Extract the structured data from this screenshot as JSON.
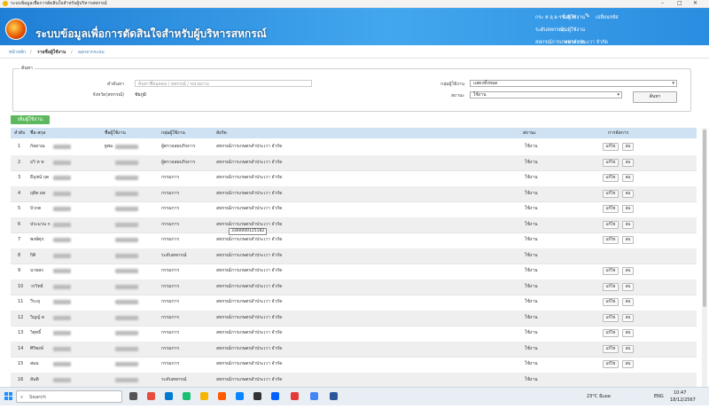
{
  "window": {
    "title": "ระบบข้อมูลเพื่อการตัดสินใจสำหรับผู้บริหารสหกรณ์",
    "controls": [
      "–",
      "□",
      "✕"
    ]
  },
  "header": {
    "site_title": "ระบบข้อมูลเพื่อการตัดสินใจสำหรับผู้บริหารสหกรณ์",
    "user_label": "ชื่อผู้ใช้งาน",
    "user_value": "กระ ห ลุ ผ-ร ะ ถิ ต",
    "group_label": "กลุ่มผู้ใช้งาน",
    "group_value": "ระดับสหกรณ์",
    "unit_label": "หน่วยงาน",
    "unit_value": "สหกรณ์การเกษตรลำประเวา จำกัด",
    "change_password": "เปลี่ยนรหัส"
  },
  "breadcrumb": {
    "home": "หน้าหลัก",
    "current": "รายชื่อผู้ใช้งาน",
    "logout": "ออกจากระบบ",
    "sep": "/"
  },
  "search": {
    "legend": "ค้นหา",
    "keyword_label": "คำค้นหา",
    "keyword_placeholder": "ค้นหาชื่อบุคคล / สหกรณ์ / หน่วยงาน",
    "province_label": "จังหวัด(สหกรณ์)",
    "province_value": "ชัยภูมิ",
    "group_label": "กลุ่มผู้ใช้งาน",
    "group_value": "แสดงทั้งหมด",
    "status_label": "สถานะ",
    "status_value": "ใช้งาน",
    "search_button": "ค้นหา"
  },
  "add_user_button": "เพิ่มผู้ใช้งาน",
  "table": {
    "columns": [
      "ลำดับ",
      "ชื่อ-สกุล",
      "ชื่อผู้ใช้งาน",
      "กลุ่มผู้ใช้งาน",
      "สังกัด",
      "สถานะ",
      "การจัดการ"
    ],
    "edit_label": "แก้ไข",
    "delete_label": "ลบ",
    "rows": [
      {
        "no": "1",
        "name": "กัลยาณ",
        "username": "ฐพม",
        "group": "ผู้ตรวจสอบกิจการ",
        "org": "สหกรณ์การเกษตรลำประเวา จำกัด",
        "status": "ใช้งาน"
      },
      {
        "no": "2",
        "name": "อวิ ห ท",
        "username": "",
        "group": "ผู้ตรวจสอบกิจการ",
        "org": "สหกรณ์การเกษตรลำประเวา จำกัด",
        "status": "ใช้งาน"
      },
      {
        "no": "3",
        "name": "ธีนุชน์ ฤต",
        "username": "",
        "group": "กรรมการ",
        "org": "สหกรณ์การเกษตรลำประเวา จำกัด",
        "status": "ใช้งาน"
      },
      {
        "no": "4",
        "name": "ฤดิต ผส",
        "username": "",
        "group": "กรรมการ",
        "org": "สหกรณ์การเกษตรลำประเวา จำกัด",
        "status": "ใช้งาน"
      },
      {
        "no": "5",
        "name": "บัวกต",
        "username": "",
        "group": "กรรมการ",
        "org": "สหกรณ์การเกษตรลำประเวา จำกัด",
        "status": "ใช้งาน"
      },
      {
        "no": "6",
        "name": "ประมวน ก",
        "username": "",
        "group": "กรรมการ",
        "org": "สหกรณ์การเกษตรลำประเวา จำกัด",
        "status": "ใช้งาน"
      },
      {
        "no": "7",
        "name": "พงษ์ศุภ",
        "username": "",
        "group": "กรรมการ",
        "org": "สหกรณ์การเกษตรลำประเวา จำกัด",
        "status": "ใช้งาน"
      },
      {
        "no": "8",
        "name": "กิติ",
        "username": "",
        "group": "ระดับสหกรณ์",
        "org": "สหกรณ์การเกษตรลำประเวา จำกัด",
        "status": "ใช้งาน"
      },
      {
        "no": "9",
        "name": "นายสง",
        "username": "",
        "group": "กรรมการ",
        "org": "สหกรณ์การเกษตรลำประเวา จำกัด",
        "status": "ใช้งาน"
      },
      {
        "no": "10",
        "name": "วรวิทย์",
        "username": "",
        "group": "กรรมการ",
        "org": "สหกรณ์การเกษตรลำประเวา จำกัด",
        "status": "ใช้งาน"
      },
      {
        "no": "11",
        "name": "วีระยุ",
        "username": "",
        "group": "กรรมการ",
        "org": "สหกรณ์การเกษตรลำประเวา จำกัด",
        "status": "ใช้งาน"
      },
      {
        "no": "12",
        "name": "วิญญ์ ค",
        "username": "",
        "group": "กรรมการ",
        "org": "สหกรณ์การเกษตรลำประเวา จำกัด",
        "status": "ใช้งาน"
      },
      {
        "no": "13",
        "name": "วิสุทธิ์",
        "username": "",
        "group": "กรรมการ",
        "org": "สหกรณ์การเกษตรลำประเวา จำกัด",
        "status": "ใช้งาน"
      },
      {
        "no": "14",
        "name": "ศิริพงษ์",
        "username": "",
        "group": "กรรมการ",
        "org": "สหกรณ์การเกษตรลำประเวา จำกัด",
        "status": "ใช้งาน"
      },
      {
        "no": "15",
        "name": "สมม",
        "username": "",
        "group": "กรรมการ",
        "org": "สหกรณ์การเกษตรลำประเวา จำกัด",
        "status": "ใช้งาน"
      },
      {
        "no": "16",
        "name": "สันติ",
        "username": "",
        "group": "ระดับสหกรณ์",
        "org": "สหกรณ์การเกษตรลำประเวา จำกัด",
        "status": "ใช้งาน"
      }
    ],
    "tooltip": "3360000125182"
  },
  "taskbar": {
    "search_placeholder": "Search",
    "weather": "23°C มีแดด",
    "lang": "ENG",
    "time": "10:47",
    "date": "18/12/2567"
  }
}
